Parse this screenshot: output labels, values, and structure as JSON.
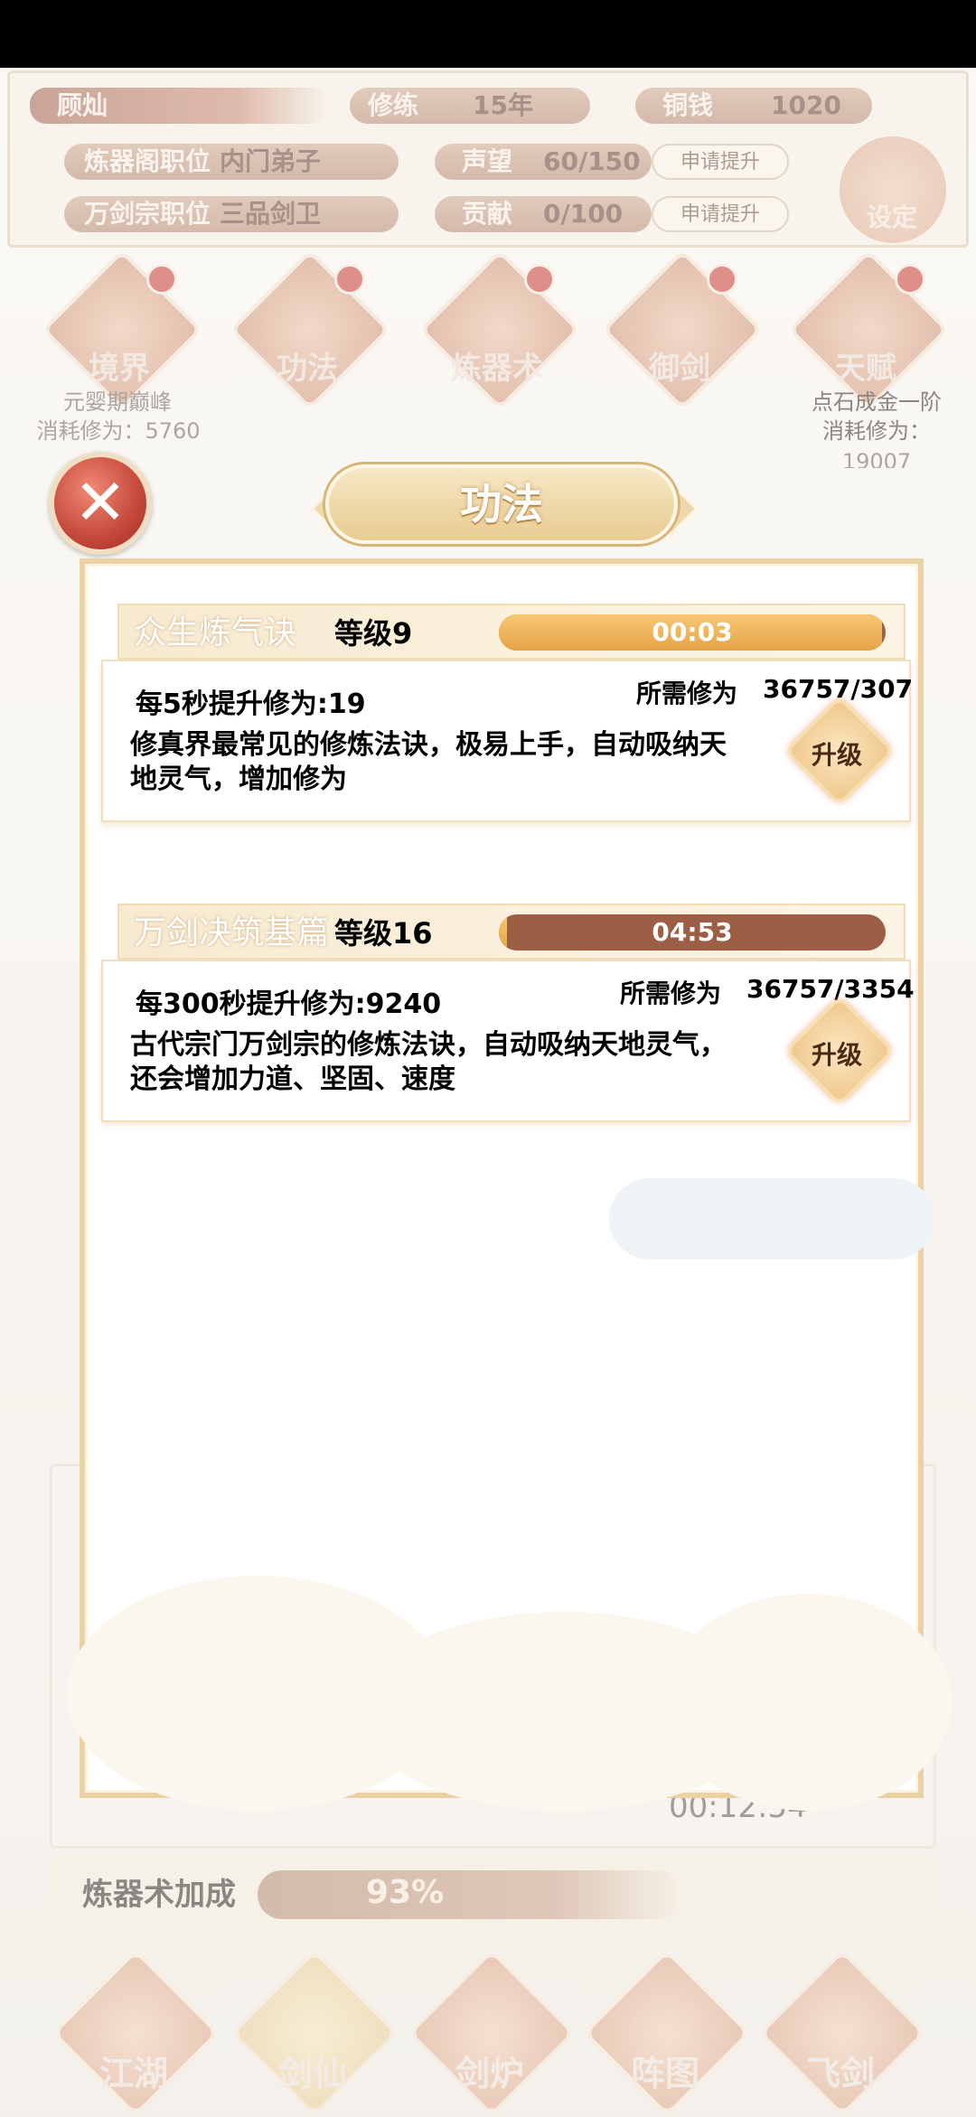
{
  "background": {
    "name": "顾灿",
    "cultivation_label": "修练",
    "cultivation_value": "15年",
    "money_label": "铜钱",
    "money_value": "1020",
    "forge_position_label": "炼器阁职位",
    "forge_position_value": "内门弟子",
    "sect_position_label": "万剑宗职位",
    "sect_position_value": "三品剑卫",
    "reputation_label": "声望",
    "reputation_value": "60/150",
    "contribution_label": "贡献",
    "contribution_value": "0/100",
    "apply_label": "申请提升",
    "settings_label": "设定",
    "icons": [
      {
        "label": "境界"
      },
      {
        "label": "功法"
      },
      {
        "label": "炼器术"
      },
      {
        "label": "御剑"
      },
      {
        "label": "天赋"
      }
    ],
    "realm_text": "元婴期巅峰",
    "realm_cost": "消耗修为：5760",
    "talent_text": "点石成金一阶",
    "talent_cost_label": "消耗修为：",
    "talent_cost_value": "19007",
    "timer": "00:12:54",
    "boost_label": "炼器术加成",
    "boost_value": "93%",
    "nav": [
      {
        "label": "江湖"
      },
      {
        "label": "剑仙"
      },
      {
        "label": "剑炉"
      },
      {
        "label": "阵图"
      },
      {
        "label": "飞剑"
      }
    ]
  },
  "dialog": {
    "title": "功法",
    "upgrade_label": "升级",
    "required_label": "所需修为",
    "techniques": [
      {
        "name": "众生炼气诀",
        "level": "等级9",
        "timer": "00:03",
        "progress": 0.99,
        "rate": "每5秒提升修为:19",
        "required": "36757/307",
        "description": "修真界最常见的修炼法诀，极易上手，自动吸纳天地灵气，增加修为"
      },
      {
        "name": "万剑决筑基篇",
        "level": "等级16",
        "timer": "04:53",
        "progress": 0.02,
        "rate": "每300秒提升修为:9240",
        "required": "36757/3354",
        "description": "古代宗门万剑宗的修炼法诀，自动吸纳天地灵气，还会增加力道、坚固、速度"
      }
    ]
  }
}
